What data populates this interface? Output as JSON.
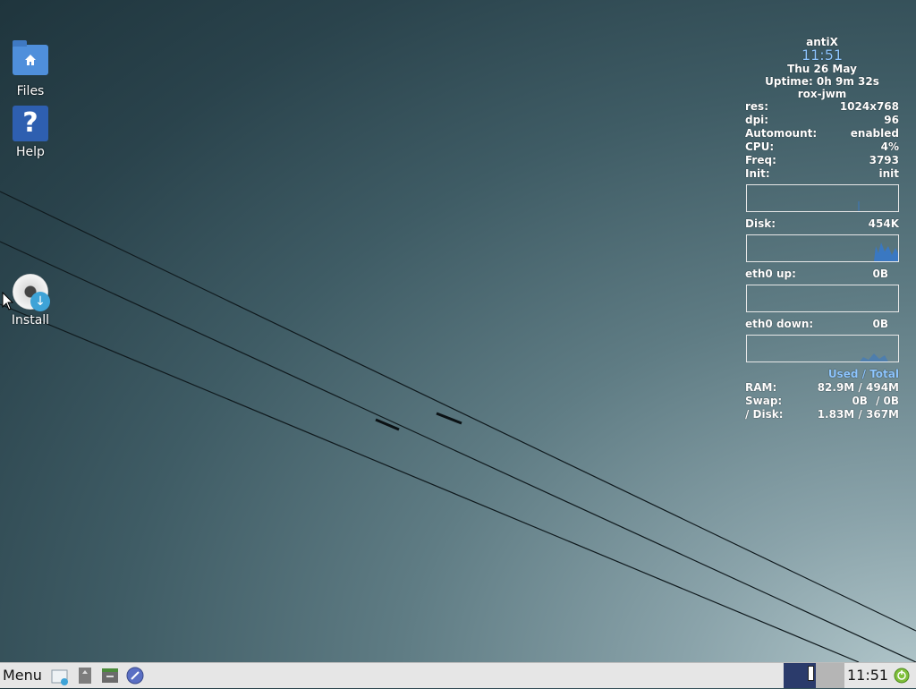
{
  "desktop": {
    "icons": [
      {
        "label": "Files",
        "icon": "folder-home-icon"
      },
      {
        "label": "Help",
        "icon": "help-icon"
      },
      {
        "label": "Install",
        "icon": "install-disc-icon"
      }
    ]
  },
  "conky": {
    "hostname": "antiX",
    "time": "11:51",
    "date": "Thu 26 May",
    "uptime": "Uptime: 0h 9m 32s",
    "wm": "rox-jwm",
    "stats": [
      {
        "label": "res:",
        "value": "1024x768"
      },
      {
        "label": "dpi:",
        "value": "96"
      },
      {
        "label": "Automount:",
        "value": "enabled"
      },
      {
        "label": "CPU:",
        "value": "4%"
      },
      {
        "label": "Freq:",
        "value": "3793"
      },
      {
        "label": "Init:",
        "value": "init"
      }
    ],
    "disk": {
      "label": "Disk:",
      "value": "454K"
    },
    "eth0_up": {
      "label": "eth0 up:",
      "value": "0B"
    },
    "eth0_down": {
      "label": "eth0 down:",
      "value": "0B"
    },
    "mem_header": {
      "used": "Used",
      "sep": "/",
      "total": "Total"
    },
    "memory": [
      {
        "label": "RAM:",
        "used": "82.9M",
        "total": "494M"
      },
      {
        "label": "Swap:",
        "used": "0B",
        "total": "0B"
      },
      {
        "label": "/ Disk:",
        "used": "1.83M",
        "total": "367M"
      }
    ],
    "accent_color": "#8ec6ff"
  },
  "taskbar": {
    "menu_label": "Menu",
    "launchers": [
      "file-manager-icon",
      "archive-icon",
      "terminal-icon",
      "browser-icon"
    ],
    "clock": "11:51",
    "pager_desktops": 2
  }
}
